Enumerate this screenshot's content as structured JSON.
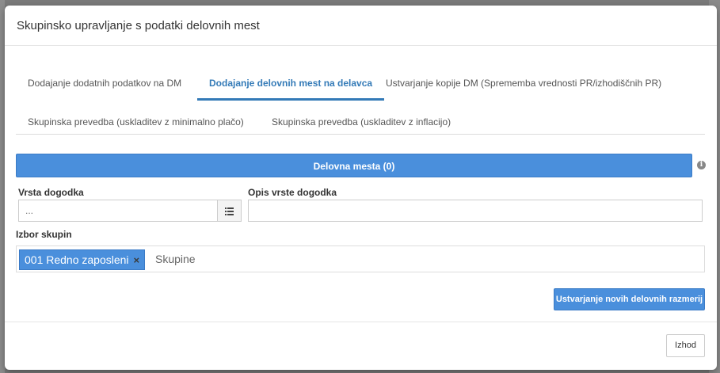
{
  "dialog": {
    "title": "Skupinsko upravljanje s podatki delovnih mest"
  },
  "tabs": [
    {
      "label": "Dodajanje dodatnih podatkov na DM",
      "active": false
    },
    {
      "label": "Dodajanje delovnih mest na delavca",
      "active": true
    },
    {
      "label": "Ustvarjanje kopije DM (Sprememba vrednosti PR/izhodiščnih PR)",
      "active": false
    },
    {
      "label": "Skupinska prevedba (uskladitev z minimalno plačo)",
      "active": false
    },
    {
      "label": "Skupinska prevedba (uskladitev z inflacijo)",
      "active": false
    }
  ],
  "section_bar": {
    "label": "Delovna mesta (0)",
    "info_icon": "info-icon"
  },
  "form": {
    "event_type_label": "Vrsta dogodka",
    "event_type_placeholder": "...",
    "event_type_list_icon": "list-icon",
    "event_desc_label": "Opis vrste dogodka",
    "event_desc_value": "",
    "groups_label": "Izbor skupin",
    "groups_selected": [
      {
        "label": "001 Redno zaposleni",
        "remove": "×"
      }
    ],
    "groups_placeholder": "Skupine"
  },
  "actions": {
    "create_label": "Ustvarjanje novih delovnih razmerij",
    "exit_label": "Izhod"
  },
  "colors": {
    "accent": "#4a8fdc",
    "active_tab": "#337ab7"
  }
}
